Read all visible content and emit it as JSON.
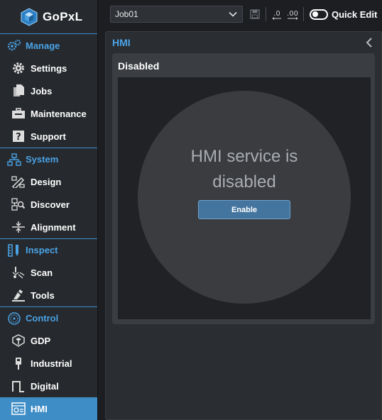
{
  "app": {
    "name": "GoPxL"
  },
  "toolbar": {
    "job": "Job01",
    "icons": [
      "save-icon",
      "decimal-decrease-icon",
      "decimal-increase-icon"
    ],
    "decimal_decrease_label": ".0",
    "decimal_increase_label": ".00",
    "quick_edit_label": "Quick Edit",
    "quick_edit_on": false
  },
  "sidebar": {
    "sections": [
      {
        "title": "Manage",
        "icon": "gears-icon",
        "items": [
          {
            "label": "Settings",
            "icon": "gear-icon"
          },
          {
            "label": "Jobs",
            "icon": "files-icon"
          },
          {
            "label": "Maintenance",
            "icon": "toolbox-icon"
          },
          {
            "label": "Support",
            "icon": "question-icon"
          }
        ]
      },
      {
        "title": "System",
        "icon": "network-icon",
        "items": [
          {
            "label": "Design",
            "icon": "design-icon"
          },
          {
            "label": "Discover",
            "icon": "discover-icon"
          },
          {
            "label": "Alignment",
            "icon": "alignment-icon"
          }
        ]
      },
      {
        "title": "Inspect",
        "icon": "ruler-icon",
        "items": [
          {
            "label": "Scan",
            "icon": "scan-icon"
          },
          {
            "label": "Tools",
            "icon": "tools-icon"
          }
        ]
      },
      {
        "title": "Control",
        "icon": "control-icon",
        "items": [
          {
            "label": "GDP",
            "icon": "gdp-icon"
          },
          {
            "label": "Industrial",
            "icon": "plug-icon"
          },
          {
            "label": "Digital",
            "icon": "pulse-icon"
          },
          {
            "label": "HMI",
            "icon": "hmi-icon",
            "active": true
          }
        ]
      }
    ]
  },
  "panel": {
    "title": "HMI",
    "card_title": "Disabled",
    "message": "HMI service is\ndisabled",
    "enable_label": "Enable"
  },
  "colors": {
    "accent": "#4aa3e6",
    "active": "#3f8dc6",
    "button": "#44759e"
  }
}
